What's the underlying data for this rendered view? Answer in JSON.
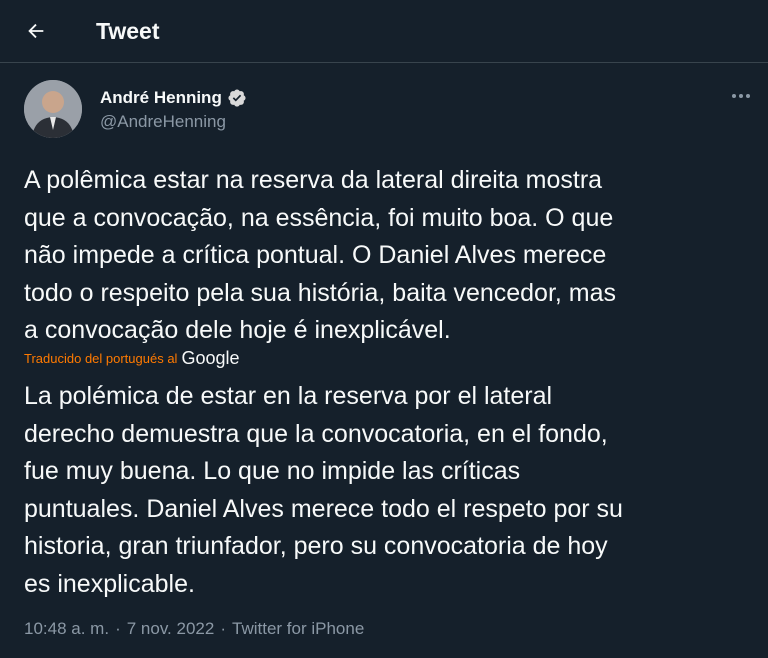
{
  "header": {
    "title": "Tweet",
    "back_icon": "arrow-left-icon"
  },
  "author": {
    "name": "André Henning",
    "handle": "@AndreHenning",
    "verified_icon": "verified-badge-icon",
    "verified_color": "#d9d9d9"
  },
  "tweet": {
    "text_lines": [
      "A polêmica estar na reserva da lateral direita mostra",
      "que a convocação, na essência, foi muito boa. O que",
      "não impede a crítica pontual. O Daniel Alves merece",
      "todo o respeito pela sua história, baita vencedor, mas",
      "a convocação dele hoje é inexplicável."
    ],
    "translated_label": "Traducido del portugués al",
    "translator": "Google",
    "translation_lines": [
      "La polémica de estar en la reserva por el lateral",
      "derecho demuestra que la convocatoria, en el fondo,",
      "fue muy buena. Lo que no impide las críticas",
      "puntuales. Daniel Alves merece todo el respeto por su",
      "historia, gran triunfador, pero su convocatoria de hoy",
      "es inexplicable."
    ]
  },
  "meta": {
    "time": "10:48 a. m.",
    "separator": "·",
    "date": "7 nov. 2022",
    "source": "Twitter for iPhone"
  },
  "colors": {
    "background": "#15202b",
    "text": "#f7f9f9",
    "secondary": "#8b98a5",
    "translate_accent": "#ff7a00"
  }
}
